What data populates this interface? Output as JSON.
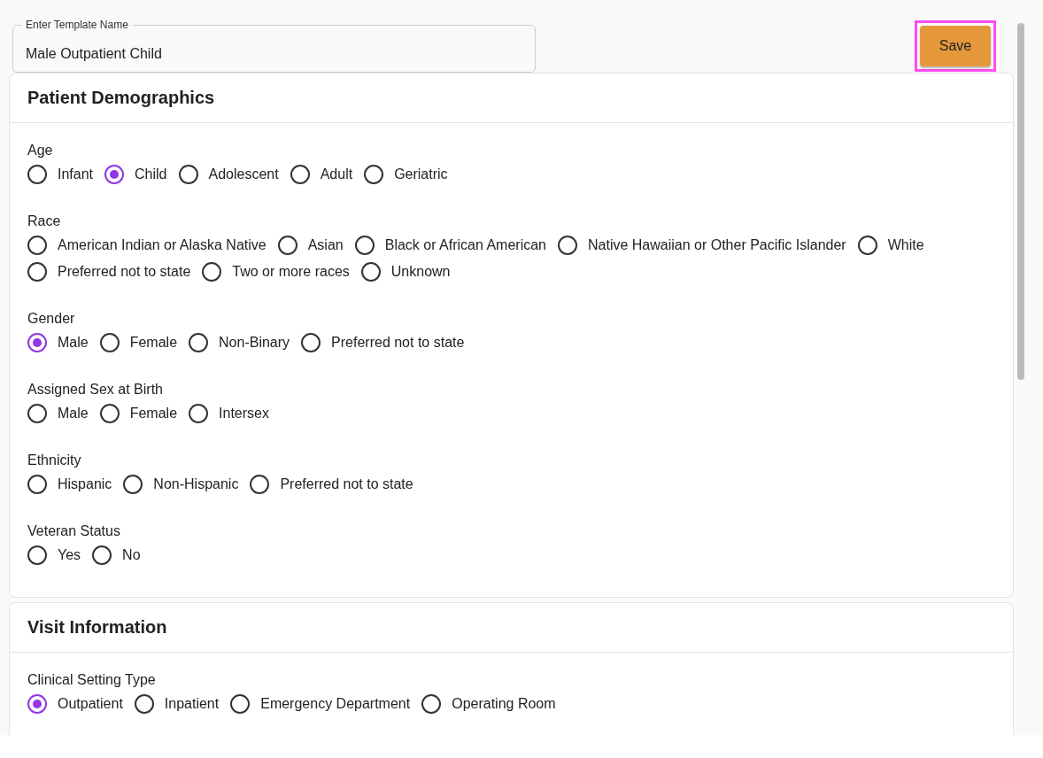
{
  "template_name": {
    "label": "Enter Template Name",
    "value": "Male Outpatient Child"
  },
  "save_button": {
    "label": "Save",
    "focused": true
  },
  "sections": [
    {
      "title": "Patient Demographics",
      "groups": [
        {
          "label": "Age",
          "rows": [
            [
              {
                "label": "Infant",
                "selected": false
              },
              {
                "label": "Child",
                "selected": true
              },
              {
                "label": "Adolescent",
                "selected": false
              },
              {
                "label": "Adult",
                "selected": false
              },
              {
                "label": "Geriatric",
                "selected": false
              }
            ]
          ]
        },
        {
          "label": "Race",
          "rows": [
            [
              {
                "label": "American Indian or Alaska Native",
                "selected": false
              },
              {
                "label": "Asian",
                "selected": false
              },
              {
                "label": "Black or African American",
                "selected": false
              },
              {
                "label": "Native Hawaiian or Other Pacific Islander",
                "selected": false
              },
              {
                "label": "White",
                "selected": false
              }
            ],
            [
              {
                "label": "Preferred not to state",
                "selected": false
              },
              {
                "label": "Two or more races",
                "selected": false
              },
              {
                "label": "Unknown",
                "selected": false
              }
            ]
          ]
        },
        {
          "label": "Gender",
          "rows": [
            [
              {
                "label": "Male",
                "selected": true
              },
              {
                "label": "Female",
                "selected": false
              },
              {
                "label": "Non-Binary",
                "selected": false
              },
              {
                "label": "Preferred not to state",
                "selected": false
              }
            ]
          ]
        },
        {
          "label": "Assigned Sex at Birth",
          "rows": [
            [
              {
                "label": "Male",
                "selected": false
              },
              {
                "label": "Female",
                "selected": false
              },
              {
                "label": "Intersex",
                "selected": false
              }
            ]
          ]
        },
        {
          "label": "Ethnicity",
          "rows": [
            [
              {
                "label": "Hispanic",
                "selected": false
              },
              {
                "label": "Non-Hispanic",
                "selected": false
              },
              {
                "label": "Preferred not to state",
                "selected": false
              }
            ]
          ]
        },
        {
          "label": "Veteran Status",
          "rows": [
            [
              {
                "label": "Yes",
                "selected": false
              },
              {
                "label": "No",
                "selected": false
              }
            ]
          ]
        }
      ]
    },
    {
      "title": "Visit Information",
      "groups": [
        {
          "label": "Clinical Setting Type",
          "rows": [
            [
              {
                "label": "Outpatient",
                "selected": true
              },
              {
                "label": "Inpatient",
                "selected": false
              },
              {
                "label": "Emergency Department",
                "selected": false
              },
              {
                "label": "Operating Room",
                "selected": false
              }
            ]
          ]
        }
      ]
    }
  ]
}
